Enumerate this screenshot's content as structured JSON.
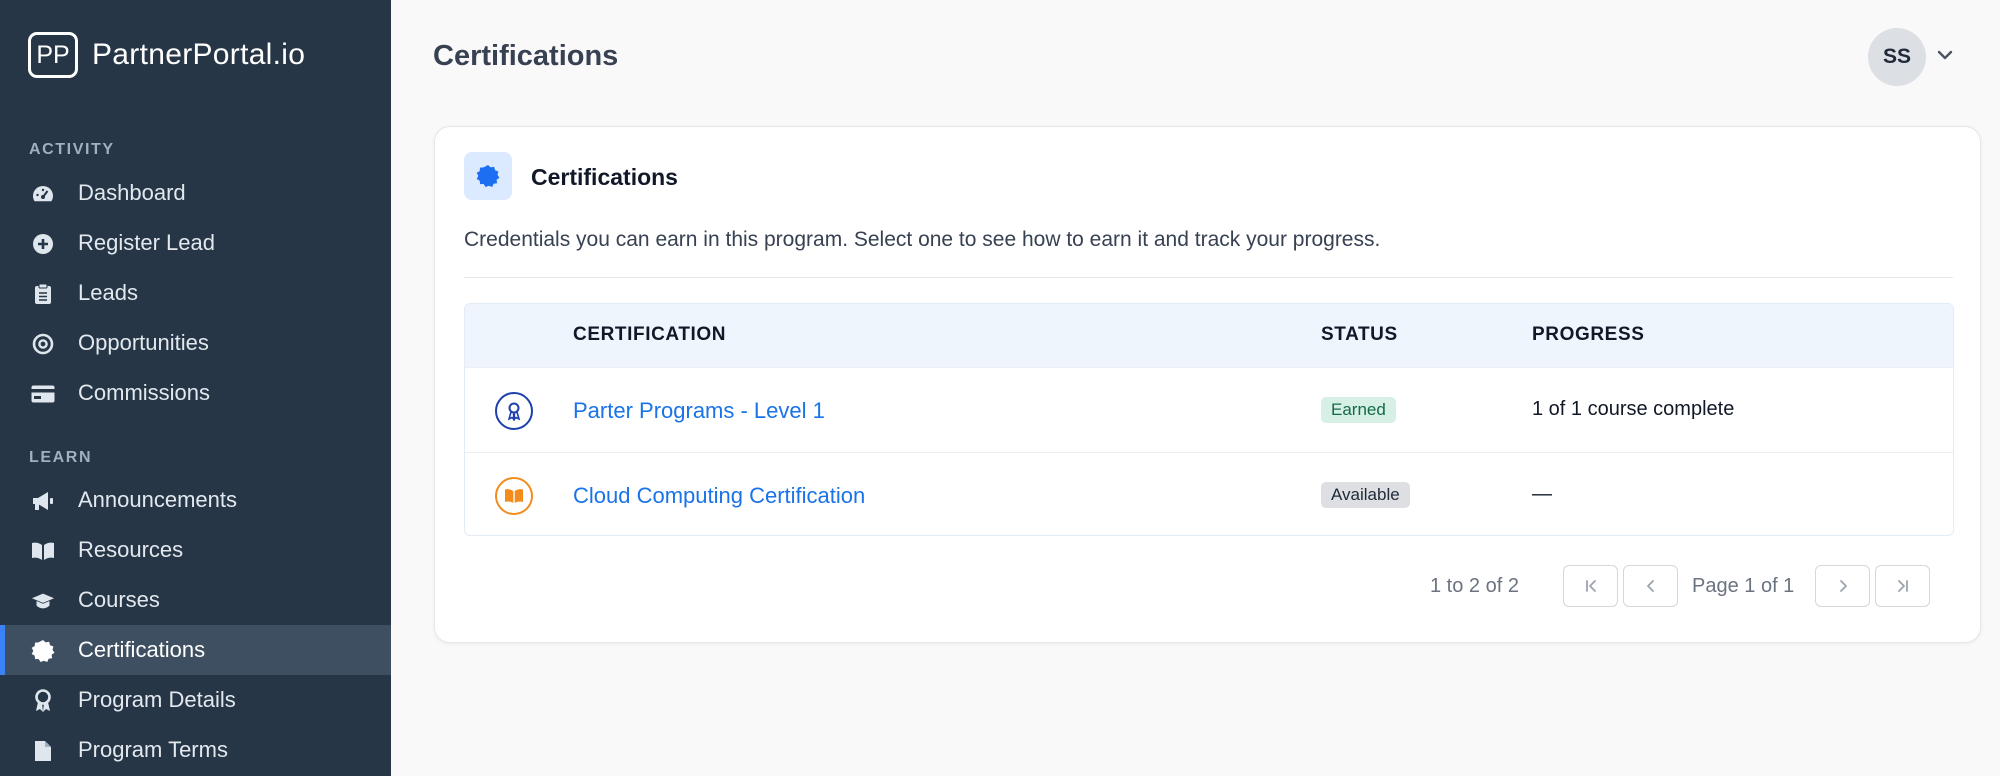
{
  "brand": {
    "logo_text": "PP",
    "name": "PartnerPortal.io"
  },
  "sidebar": {
    "sections": [
      {
        "label": "ACTIVITY"
      },
      {
        "label": "LEARN"
      }
    ],
    "items": [
      {
        "label": "Dashboard",
        "icon": "gauge-icon"
      },
      {
        "label": "Register Lead",
        "icon": "plus-circle-icon"
      },
      {
        "label": "Leads",
        "icon": "clipboard-icon"
      },
      {
        "label": "Opportunities",
        "icon": "target-icon"
      },
      {
        "label": "Commissions",
        "icon": "credit-card-icon"
      },
      {
        "label": "Announcements",
        "icon": "megaphone-icon"
      },
      {
        "label": "Resources",
        "icon": "book-icon"
      },
      {
        "label": "Courses",
        "icon": "graduation-cap-icon"
      },
      {
        "label": "Certifications",
        "icon": "certificate-icon",
        "active": true
      },
      {
        "label": "Program Details",
        "icon": "award-icon"
      },
      {
        "label": "Program Terms",
        "icon": "file-icon"
      }
    ]
  },
  "header": {
    "title": "Certifications",
    "user_initials": "SS"
  },
  "card": {
    "title": "Certifications",
    "description": "Credentials you can earn in this program. Select one to see how to earn it and track your progress.",
    "table": {
      "columns": [
        "CERTIFICATION",
        "STATUS",
        "PROGRESS"
      ],
      "rows": [
        {
          "name": "Parter Programs - Level 1",
          "status": "Earned",
          "progress": "1 of 1 course complete",
          "icon": "award-ribbon-icon"
        },
        {
          "name": "Cloud Computing Certification",
          "status": "Available",
          "progress": "—",
          "icon": "open-book-icon"
        }
      ]
    },
    "pagination": {
      "summary": "1 to 2 of 2",
      "page_label": "Page 1 of 1"
    }
  },
  "colors": {
    "sidebar_bg": "#263646",
    "accent": "#3b82f6",
    "link": "#1a73e8",
    "earned_bg": "#d7f0e5",
    "available_bg": "#dddfe2"
  }
}
